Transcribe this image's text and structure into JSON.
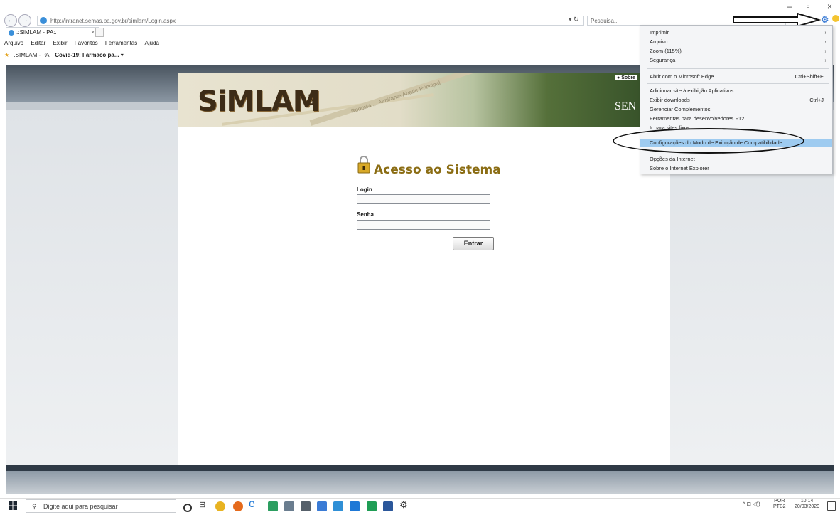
{
  "browser": {
    "url": "http://intranet.semas.pa.gov.br/simlam/Login.aspx",
    "refresh_label": "▾ ↻",
    "search_placeholder": "Pesquisa...",
    "tab_title": ".:SIMLAM - PA:.",
    "tab_close": "×",
    "window_controls": {
      "minimize": "–",
      "maximize": "▫",
      "close": "×"
    },
    "menu": [
      "Arquivo",
      "Editar",
      "Exibir",
      "Favoritos",
      "Ferramentas",
      "Ajuda"
    ],
    "favorites": [
      {
        "label": ".SIMLAM - PA"
      },
      {
        "label": "Covid-19: Fármaco pa...",
        "suffix": "▾"
      }
    ]
  },
  "tools_menu": {
    "items": [
      {
        "label": "Imprimir",
        "arrow": "›"
      },
      {
        "label": "Arquivo",
        "arrow": "›"
      },
      {
        "label": "Zoom (115%)",
        "arrow": "›"
      },
      {
        "label": "Segurança",
        "arrow": "›"
      },
      {
        "label": "Abrir com o Microsoft Edge",
        "shortcut": "Ctrl+Shift+E"
      },
      {
        "label": "Adicionar site à exibição Aplicativos"
      },
      {
        "label": "Exibir downloads",
        "shortcut": "Ctrl+J"
      },
      {
        "label": "Gerenciar Complementos"
      },
      {
        "label": "Ferramentas para desenvolvedores F12"
      },
      {
        "label": "Ir para sites fixos"
      },
      {
        "label": "Configurações do Modo de Exibição de Compatibilidade",
        "highlighted": true
      },
      {
        "label": "Opções da Internet"
      },
      {
        "label": "Sobre o Internet Explorer"
      }
    ]
  },
  "page": {
    "logo_text": "SiMLAM",
    "logo_suffix": "PA",
    "banner_road_text": "Rodovia ... Almirante Abade Principal",
    "sobre_link": "Sobre",
    "banner_right_text": "SEN",
    "login_title": "Acesso ao Sistema",
    "login_label": "Login",
    "senha_label": "Senha",
    "submit_label": "Entrar"
  },
  "taskbar": {
    "search_placeholder": "Digite aqui para pesquisar",
    "language": "POR",
    "language_sub": "PTB2",
    "time": "10:14",
    "date": "20/03/2020",
    "tray_glyphs": "^ ⊡ ◁))",
    "colors": {
      "edge_blue": "#1e78d6",
      "chrome": "#e8b321",
      "firefox": "#e56a1c"
    }
  }
}
